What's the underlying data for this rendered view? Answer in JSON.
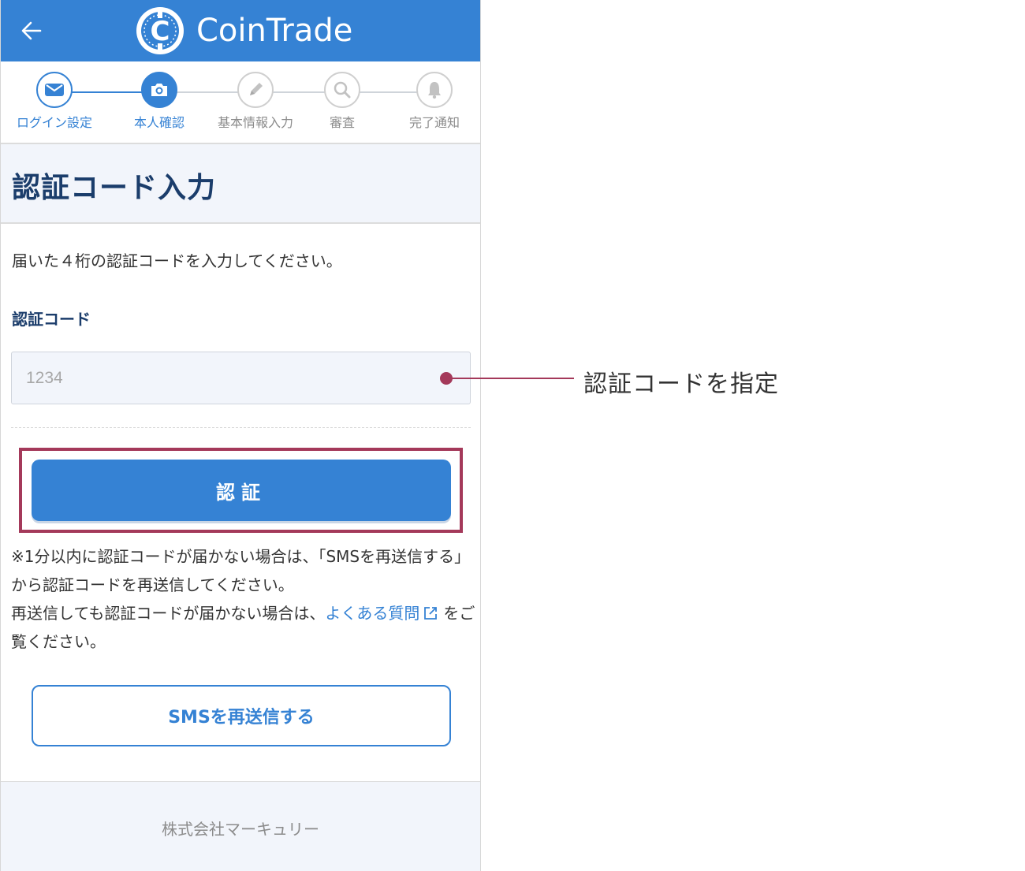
{
  "header": {
    "app_name": "CoinTrade",
    "logo_letter": "C"
  },
  "steps": [
    {
      "label": "ログイン設定",
      "state": "done"
    },
    {
      "label": "本人確認",
      "state": "current"
    },
    {
      "label": "基本情報入力",
      "state": "todo"
    },
    {
      "label": "審査",
      "state": "todo"
    },
    {
      "label": "完了通知",
      "state": "todo"
    }
  ],
  "page": {
    "title": "認証コード入力",
    "description": "届いた４桁の認証コードを入力してください。",
    "field_label": "認証コード",
    "code_placeholder": "1234",
    "auth_button_label": "認証",
    "note_line1": "※1分以内に認証コードが届かない場合は、「SMSを再送信する」から認証コードを再送信してください。",
    "note_line2_prefix": "再送信しても認証コードが届かない場合は、",
    "faq_link_label": "よくある質問",
    "note_line2_suffix": "をご覧ください。",
    "resend_button_label": "SMSを再送信する"
  },
  "footer": {
    "company": "株式会社マーキュリー"
  },
  "annotation": {
    "callout_text": "認証コードを指定"
  },
  "colors": {
    "primary": "#3582d4",
    "highlight": "#a4395a",
    "title": "#1b3d6b"
  }
}
